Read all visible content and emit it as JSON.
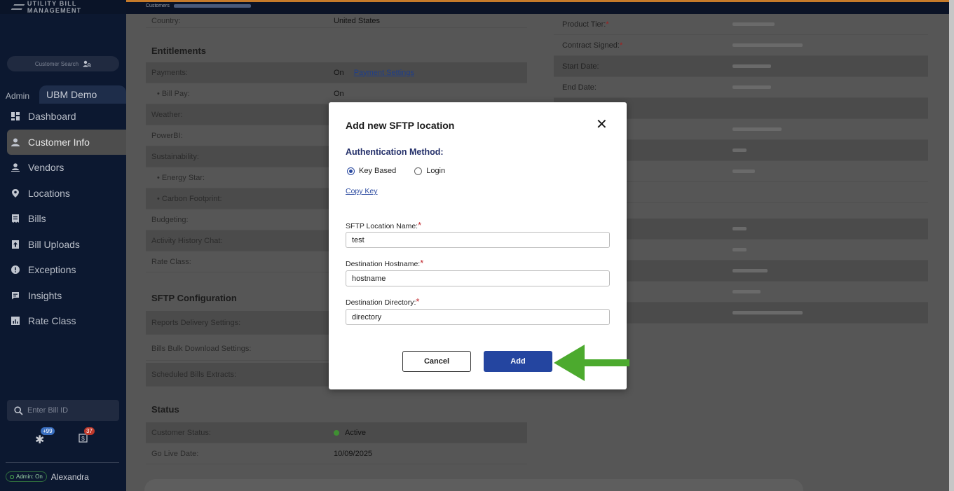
{
  "brand": {
    "title": "UTILITY BILL MANAGEMENT"
  },
  "sidebar": {
    "customer_search": "Customer Search",
    "role_label": "Admin",
    "role_tab": "UBM Demo",
    "items": [
      {
        "label": "Dashboard",
        "icon": "dashboard-icon"
      },
      {
        "label": "Customer Info",
        "icon": "person-icon",
        "active": true
      },
      {
        "label": "Vendors",
        "icon": "vendor-icon"
      },
      {
        "label": "Locations",
        "icon": "location-pin-icon"
      },
      {
        "label": "Bills",
        "icon": "bill-icon"
      },
      {
        "label": "Bill Uploads",
        "icon": "upload-icon"
      },
      {
        "label": "Exceptions",
        "icon": "exclamation-icon"
      },
      {
        "label": "Insights",
        "icon": "insights-icon"
      },
      {
        "label": "Rate Class",
        "icon": "rate-class-icon"
      }
    ],
    "bill_search_placeholder": "Enter Bill ID",
    "badge1": "+99",
    "badge2": "37",
    "admin_status": "Admin: On",
    "user_name": "Alexandra"
  },
  "topbar": {
    "breadcrumb": "Customers"
  },
  "main": {
    "country_label": "Country:",
    "country_value": "United States",
    "entitlements_title": "Entitlements",
    "entitlements": [
      {
        "label": "Payments:",
        "value": "On",
        "link": "Payment Settings"
      },
      {
        "label": "• Bill Pay:",
        "value": "On"
      },
      {
        "label": "Weather:"
      },
      {
        "label": "PowerBI:"
      },
      {
        "label": "Sustainability:"
      },
      {
        "label": "• Energy Star:"
      },
      {
        "label": "• Carbon Footprint:"
      },
      {
        "label": "Budgeting:"
      },
      {
        "label": "Activity History Chat:"
      },
      {
        "label": "Rate Class:"
      }
    ],
    "sftp_title": "SFTP Configuration",
    "sftp": [
      {
        "label": "Reports Delivery Settings:"
      },
      {
        "label": "Bills Bulk Download Settings:"
      },
      {
        "label": "Scheduled Bills Extracts:"
      }
    ],
    "status_title": "Status",
    "status": [
      {
        "label": "Customer Status:",
        "value": "Active"
      },
      {
        "label": "Go Live Date:",
        "value": "10/09/2025"
      }
    ],
    "right": [
      {
        "label": "Product Tier:",
        "required": "*"
      },
      {
        "label": "Contract Signed:",
        "required": "*"
      },
      {
        "label": "Start Date:"
      },
      {
        "label": "End Date:"
      }
    ]
  },
  "modal": {
    "title": "Add new SFTP location",
    "close": "✕",
    "auth_title": "Authentication Method:",
    "options": [
      "Key Based",
      "Login"
    ],
    "selected_option": "Key Based",
    "copy_key": "Copy Key",
    "fields": [
      {
        "label": "SFTP Location Name:",
        "required": "*",
        "value": "test"
      },
      {
        "label": "Destination Hostname:",
        "required": "*",
        "value": "hostname"
      },
      {
        "label": "Destination Directory:",
        "required": "*",
        "value": "directory"
      }
    ],
    "cancel": "Cancel",
    "add": "Add"
  },
  "colors": {
    "accent": "#2445a0",
    "sidebar": "#0c1830",
    "arrow": "#4caa2e",
    "required": "#c0272d"
  }
}
